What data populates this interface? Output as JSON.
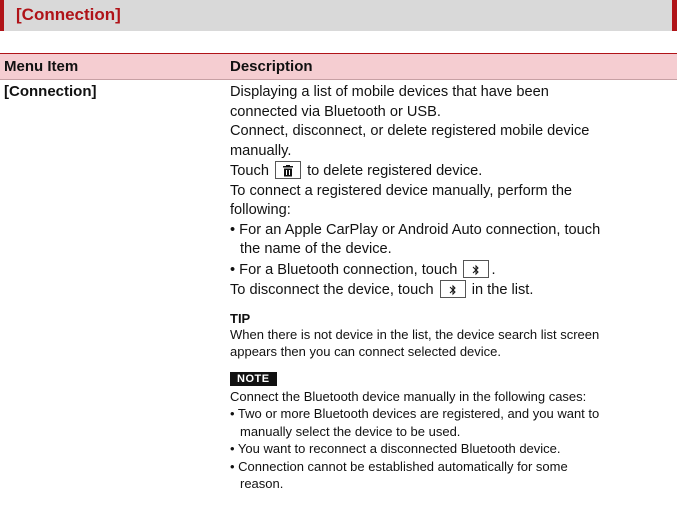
{
  "section": {
    "title": "[Connection]"
  },
  "table": {
    "headers": {
      "item": "Menu Item",
      "description": "Description"
    },
    "row": {
      "item": "[Connection]",
      "lines": {
        "l1": "Displaying a list of mobile devices that have been",
        "l2": "connected via Bluetooth or USB.",
        "l3": "Connect, disconnect, or delete registered mobile device",
        "l4": "manually.",
        "l5_pre": "Touch",
        "l5_post": "to delete registered device.",
        "l6": "To connect a registered device manually, perform the",
        "l7": "following:",
        "l8": "• For an Apple CarPlay or Android Auto connection, touch",
        "l9": "the name of the device.",
        "l10_pre": "• For a Bluetooth connection, touch",
        "l10_post": ".",
        "l11_pre": "To disconnect the device, touch",
        "l11_post": "in the list."
      },
      "tip": {
        "label": "TIP",
        "l1": "When there is not device in the list, the device search list screen",
        "l2": "appears then you can connect selected device."
      },
      "note": {
        "label": "NOTE",
        "l1": "Connect the Bluetooth device manually in the following cases:",
        "b1a": "• Two or more Bluetooth devices are registered, and you want to",
        "b1b": "manually select the device to be used.",
        "b2": "• You want to reconnect a disconnected Bluetooth device.",
        "b3a": "• Connection cannot be established automatically for some",
        "b3b": "reason."
      }
    }
  },
  "icons": {
    "trash": "trash-icon",
    "bluetooth": "bluetooth-icon"
  }
}
